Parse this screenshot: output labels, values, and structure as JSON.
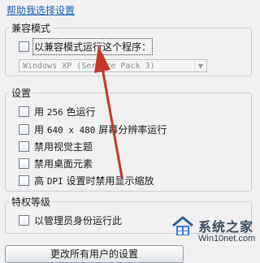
{
  "help_link": "帮助我选择设置",
  "compat_group": {
    "title": "兼容模式",
    "checkbox_label": "以兼容模式运行这个程序：",
    "os_select_value": "Windows XP (Service Pack 3)"
  },
  "settings_group": {
    "title": "设置",
    "options": [
      {
        "prefix": "用 ",
        "num": "256",
        "suffix": " 色运行"
      },
      {
        "prefix": "用 ",
        "num": "640 x 480",
        "suffix": " 屏幕分辨率运行"
      },
      {
        "label": "禁用视觉主题"
      },
      {
        "label": "禁用桌面元素"
      },
      {
        "prefix": "高 ",
        "num": "DPI",
        "suffix": " 设置时禁用显示缩放"
      }
    ]
  },
  "privilege_group": {
    "title": "特权等级",
    "checkbox_label": "以管理员身份运行此"
  },
  "bottom_button": "更改所有用户的设置",
  "watermark": {
    "title": "系统之家",
    "url": "Win10net.com"
  },
  "colors": {
    "annotation_arrow": "#c0392b",
    "link": "#1a5fb4"
  }
}
